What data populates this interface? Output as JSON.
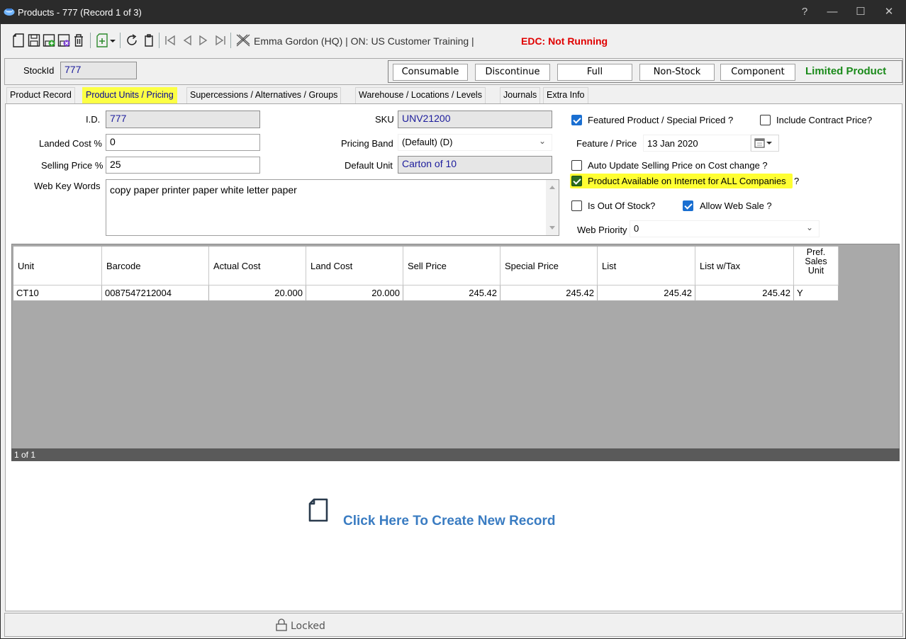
{
  "window": {
    "title": "Products - 777  (Record 1 of 3)",
    "controls": {
      "help": "?",
      "minimize": "—",
      "maximize": "☐",
      "close": "✕"
    }
  },
  "toolbar": {
    "user_info": "Emma Gordon (HQ) | ON: US Customer Training |",
    "edc_status": "EDC: Not Running",
    "icons": [
      "new-icon",
      "save-icon",
      "save-new-icon",
      "save-close-icon",
      "delete-icon",
      "add-dropdown-icon",
      "refresh-icon",
      "clipboard-icon",
      "first-record-icon",
      "previous-record-icon",
      "next-record-icon",
      "last-record-icon",
      "close-x-icon"
    ]
  },
  "stock": {
    "label": "StockId",
    "value": "777",
    "buttons": [
      "Consumable",
      "Discontinue",
      "Full",
      "Non-Stock",
      "Component"
    ],
    "status": "Limited Product",
    "status_color": "#1a8a1a"
  },
  "tabs": [
    "Product Record",
    "Product Units / Pricing",
    "Supercessions / Alternatives / Groups",
    "Warehouse / Locations / Levels",
    "Journals",
    "Extra Info"
  ],
  "active_tab": "Product Units / Pricing",
  "form": {
    "id_label": "I.D.",
    "id_value": "777",
    "landed_cost_label": "Landed Cost %",
    "landed_cost_value": "0",
    "selling_price_label": "Selling Price %",
    "selling_price_value": "25",
    "web_keywords_label": "Web Key Words",
    "web_keywords_value": "copy paper printer paper white letter paper",
    "sku_label": "SKU",
    "sku_value": "UNV21200",
    "pricing_band_label": "Pricing Band",
    "pricing_band_value": "(Default)   (D)",
    "default_unit_label": "Default Unit",
    "default_unit_value": "Carton of 10",
    "featured_label": "Featured Product / Special Priced ?",
    "featured_checked": true,
    "include_contract_label": "Include Contract Price?",
    "include_contract_checked": false,
    "feature_price_label": "Feature / Price",
    "feature_price_value": "13 Jan 2020",
    "auto_update_label": "Auto Update Selling Price on Cost change ?",
    "auto_update_checked": false,
    "available_internet_label": "Product Available on Internet for ALL Companies",
    "available_internet_suffix": "?",
    "available_internet_checked": true,
    "out_of_stock_label": "Is Out Of Stock?",
    "out_of_stock_checked": false,
    "allow_web_sale_label": "Allow Web Sale ?",
    "allow_web_sale_checked": true,
    "web_priority_label": "Web Priority",
    "web_priority_value": "0"
  },
  "grid": {
    "columns": [
      "Unit",
      "Barcode",
      "Actual Cost",
      "Land Cost",
      "Sell Price",
      "Special Price",
      "List",
      "List w/Tax"
    ],
    "pref_column": [
      "Pref.",
      "Sales",
      "Unit"
    ],
    "rows": [
      [
        "CT10",
        "0087547212004",
        "20.000",
        "20.000",
        "245.42",
        "245.42",
        "245.42",
        "245.42",
        "Y"
      ]
    ],
    "status": "1 of 1"
  },
  "create_record": {
    "text": "Click Here To Create New Record",
    "color": "#3a7cc2"
  },
  "statusbar": {
    "lock_text": "Locked"
  }
}
